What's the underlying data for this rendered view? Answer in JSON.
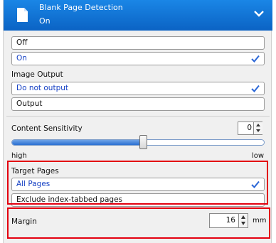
{
  "header": {
    "title": "Blank Page Detection",
    "subtitle": "On",
    "accent_color": "#0b63c4",
    "icon": "document-icon",
    "expand_icon": "chevron-down-icon"
  },
  "detection": {
    "options": [
      "Off",
      "On"
    ],
    "selected": "On"
  },
  "image_output": {
    "label": "Image Output",
    "options": [
      "Do not output",
      "Output"
    ],
    "selected": "Do not output"
  },
  "content_sensitivity": {
    "label": "Content Sensitivity",
    "value": "0",
    "left_label": "high",
    "right_label": "low",
    "level_fraction": 0.52
  },
  "target_pages": {
    "label": "Target Pages",
    "options": [
      "All Pages",
      "Exclude index-tabbed pages"
    ],
    "selected": "All Pages"
  },
  "margin": {
    "label": "Margin",
    "value": "16",
    "unit": "mm"
  },
  "highlight_color": "#e3000f",
  "selection_color": "#1540c4"
}
